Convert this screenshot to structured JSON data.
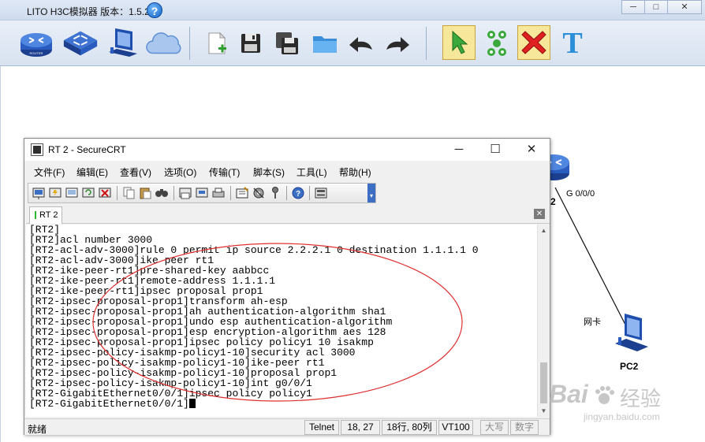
{
  "simulator": {
    "title": "LITO H3C模拟器 版本：1.5.2",
    "help_glyph": "?",
    "window_buttons": [
      "─",
      "□",
      "✕"
    ],
    "toolbar": [
      {
        "name": "router-tool",
        "icon": "router-icon"
      },
      {
        "name": "switch-tool",
        "icon": "switch-icon"
      },
      {
        "name": "pc-tool",
        "icon": "pc-icon"
      },
      {
        "name": "cloud-tool",
        "icon": "cloud-icon"
      },
      {
        "name": "new-file-tool",
        "icon": "new-file-icon"
      },
      {
        "name": "save-tool",
        "icon": "save-icon"
      },
      {
        "name": "save-as-tool",
        "icon": "save-as-icon"
      },
      {
        "name": "open-folder-tool",
        "icon": "folder-icon"
      },
      {
        "name": "undo-tool",
        "icon": "undo-icon"
      },
      {
        "name": "redo-tool",
        "icon": "redo-icon"
      },
      {
        "name": "select-tool",
        "icon": "pointer-icon"
      },
      {
        "name": "connect-tool",
        "icon": "connect-icon"
      },
      {
        "name": "delete-tool",
        "icon": "delete-icon"
      },
      {
        "name": "text-tool",
        "icon": "text-icon",
        "glyph": "T"
      }
    ]
  },
  "topology": {
    "router_label": "2",
    "interface_label": "G 0/0/0",
    "nic_label": "网卡",
    "pc_label": "PC2"
  },
  "securecrt": {
    "title": "RT 2 - SecureCRT",
    "window_buttons": [
      "─",
      "☐",
      "✕"
    ],
    "menu": [
      "文件(F)",
      "编辑(E)",
      "查看(V)",
      "选项(O)",
      "传输(T)",
      "脚本(S)",
      "工具(L)",
      "帮助(H)"
    ],
    "tab_label": "RT 2",
    "tab_close": "✕",
    "terminal_lines": [
      "[RT2]",
      "[RT2]acl number 3000",
      "[RT2-acl-adv-3000]rule 0 permit ip source 2.2.2.1 0 destination 1.1.1.1 0",
      "[RT2-acl-adv-3000]ike peer rt1",
      "[RT2-ike-peer-rt1]pre-shared-key aabbcc",
      "[RT2-ike-peer-rt1]remote-address 1.1.1.1",
      "[RT2-ike-peer-rt1]ipsec proposal prop1",
      "[RT2-ipsec-proposal-prop1]transform ah-esp",
      "[RT2-ipsec-proposal-prop1]ah authentication-algorithm sha1",
      "[RT2-ipsec-proposal-prop1]undo esp authentication-algorithm",
      "[RT2-ipsec-proposal-prop1]esp encryption-algorithm aes 128",
      "[RT2-ipsec-proposal-prop1]ipsec policy policy1 10 isakmp",
      "[RT2-ipsec-policy-isakmp-policy1-10]security acl 3000",
      "[RT2-ipsec-policy-isakmp-policy1-10]ike-peer rt1",
      "[RT2-ipsec-policy-isakmp-policy1-10]proposal prop1",
      "[RT2-ipsec-policy-isakmp-policy1-10]int g0/0/1",
      "[RT2-GigabitEthernet0/0/1]ipsec policy policy1",
      "[RT2-GigabitEthernet0/0/1]"
    ],
    "status": {
      "ready": "就绪",
      "protocol": "Telnet",
      "cursor_pos": "18, 27",
      "size": "18行, 80列",
      "emulation": "VT100",
      "caps": "大写",
      "num": "数字"
    },
    "annotation_color": "#e03030"
  },
  "watermark": {
    "brand": "Bai",
    "brand_tail": "经验",
    "url": "jingyan.baidu.com"
  }
}
